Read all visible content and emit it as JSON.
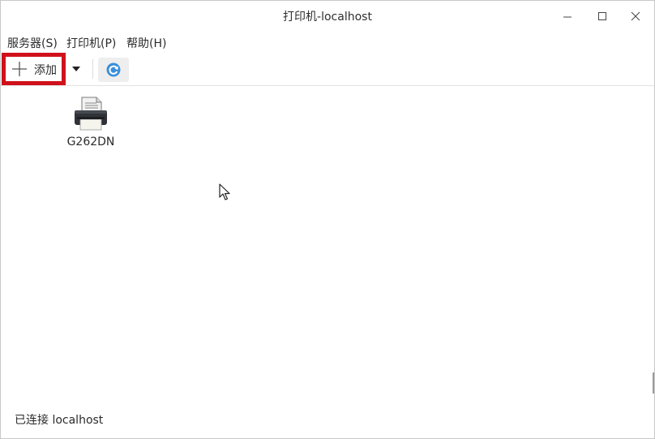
{
  "window": {
    "title": "打印机-localhost"
  },
  "menubar": {
    "items": [
      {
        "label": "服务器(S)"
      },
      {
        "label": "打印机(P)"
      },
      {
        "label": "帮助(H)"
      }
    ]
  },
  "toolbar": {
    "add_label": "添加",
    "highlight_color": "#d0111b"
  },
  "printers": [
    {
      "name": "G262DN",
      "icon": "printer-icon"
    }
  ],
  "status": {
    "text": "已连接 localhost"
  }
}
